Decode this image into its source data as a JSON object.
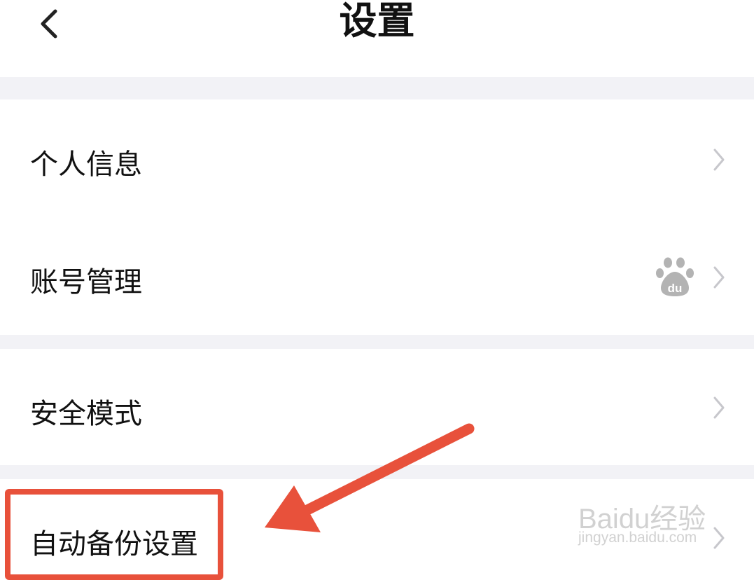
{
  "header": {
    "title": "设置",
    "back_icon": "chevron-left-icon"
  },
  "settings": {
    "items": [
      {
        "label": "个人信息",
        "icon": "chevron-right-icon"
      },
      {
        "label": "账号管理",
        "badge_icon": "baidu-paw-icon",
        "icon": "chevron-right-icon"
      },
      {
        "label": "安全模式",
        "icon": "chevron-right-icon"
      },
      {
        "label": "自动备份设置",
        "icon": "chevron-right-icon"
      }
    ]
  },
  "annotation": {
    "color": "#e8513b",
    "highlighted_item": "自动备份设置"
  },
  "watermark": {
    "brand": "Baidu经验",
    "url": "jingyan.baidu.com"
  },
  "colors": {
    "background": "#ffffff",
    "section_gap": "#f2f2f6",
    "text": "#111111",
    "chevron": "#c7c7cc",
    "annotation_red": "#e8513b"
  }
}
